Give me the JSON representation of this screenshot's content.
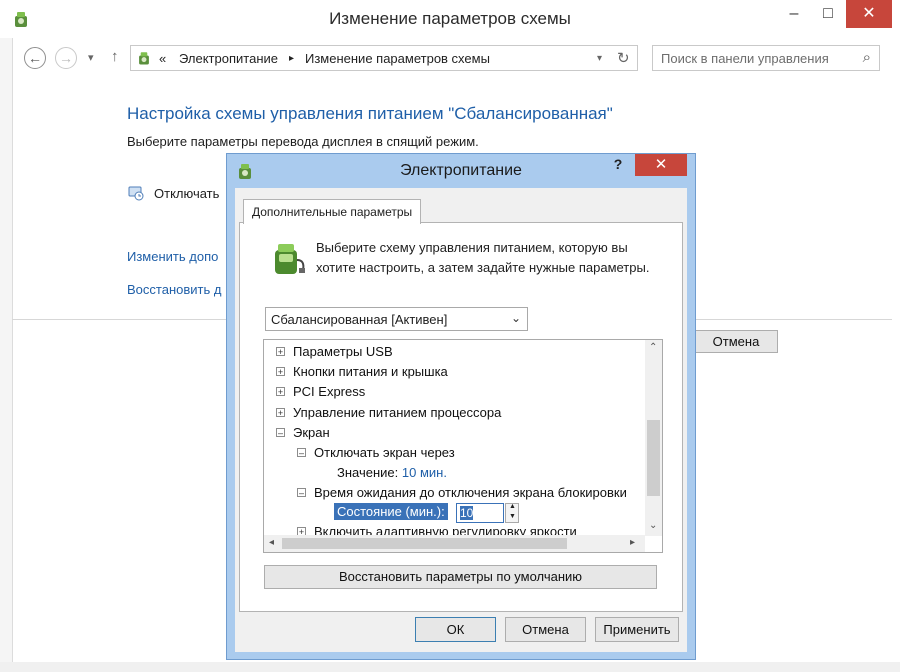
{
  "window": {
    "title": "Изменение параметров схемы",
    "minimize": "–",
    "maximize": "□",
    "close": "✕"
  },
  "address": {
    "back": "←",
    "forward": "→",
    "history": "▾",
    "up": "↑",
    "chevron": "«",
    "crumbs": [
      "Электропитание",
      "Изменение параметров схемы"
    ],
    "separator": "▸",
    "history2": "▾",
    "refresh": "↻"
  },
  "search": {
    "placeholder": "Поиск в панели управления",
    "icon": "⌕"
  },
  "content": {
    "title": "Настройка схемы управления питанием \"Сбалансированная\"",
    "subtitle": "Выберите параметры перевода дисплея в спящий режим.",
    "display_off_label": "Отключать",
    "link_change": "Изменить допо",
    "link_restore": "Восстановить д",
    "cancel_button": "Отмена"
  },
  "dialog": {
    "title": "Электропитание",
    "help": "?",
    "close": "✕",
    "tab": "Дополнительные параметры",
    "instruction": "Выберите схему управления питанием, которую вы хотите настроить, а затем задайте нужные параметры.",
    "scheme_selected": "Сбалансированная [Активен]",
    "tree": {
      "usb": "Параметры USB",
      "buttons": "Кнопки питания и крышка",
      "pci": "PCI Express",
      "cpu": "Управление питанием процессора",
      "screen": "Экран",
      "screen_off": "Отключать экран через",
      "value_label": "Значение:",
      "value": "10 мин.",
      "lock_timeout": "Время ожидания до отключения экрана блокировки",
      "state_label": "Состояние (мин.):",
      "state_value": "10",
      "adaptive": "Включить адаптивную регулировку яркости"
    },
    "restore_defaults": "Восстановить параметры по умолчанию",
    "ok": "ОК",
    "cancel": "Отмена",
    "apply": "Применить"
  }
}
